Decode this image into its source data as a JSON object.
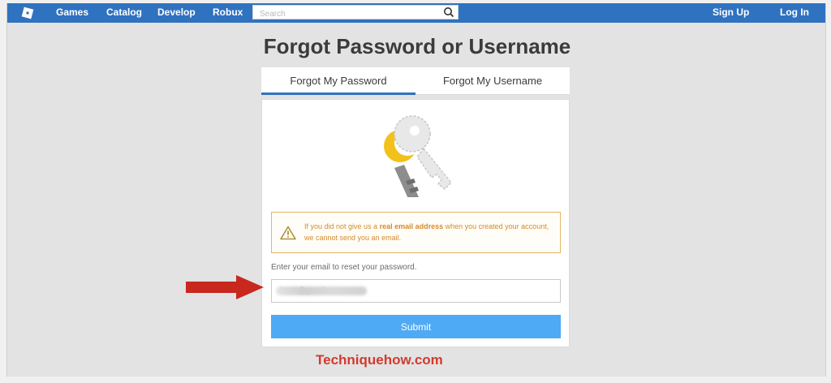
{
  "nav": {
    "games": "Games",
    "catalog": "Catalog",
    "develop": "Develop",
    "robux": "Robux",
    "search_placeholder": "Search",
    "sign_up": "Sign Up",
    "log_in": "Log In"
  },
  "page": {
    "title": "Forgot Password or Username"
  },
  "tabs": [
    {
      "label": "Forgot My Password",
      "active": true
    },
    {
      "label": "Forgot My Username",
      "active": false
    }
  ],
  "warning": {
    "text_before": "If you did not give us a ",
    "text_bold": "real email address",
    "text_after": " when you created your account, we cannot send you an email."
  },
  "form": {
    "email_label": "Enter your email to reset your password.",
    "email_value": "l*****@gmail.com",
    "submit_label": "Submit"
  },
  "watermark": "Techniquehow.com",
  "colors": {
    "nav_bar": "#2f72c0",
    "submit_button": "#4faaf5",
    "warning_border": "#e5b567",
    "annotation_arrow": "#c8281e"
  },
  "icons": [
    "roblox-logo-icon",
    "search-icon",
    "key-icon",
    "warning-icon",
    "red-arrow-icon"
  ]
}
